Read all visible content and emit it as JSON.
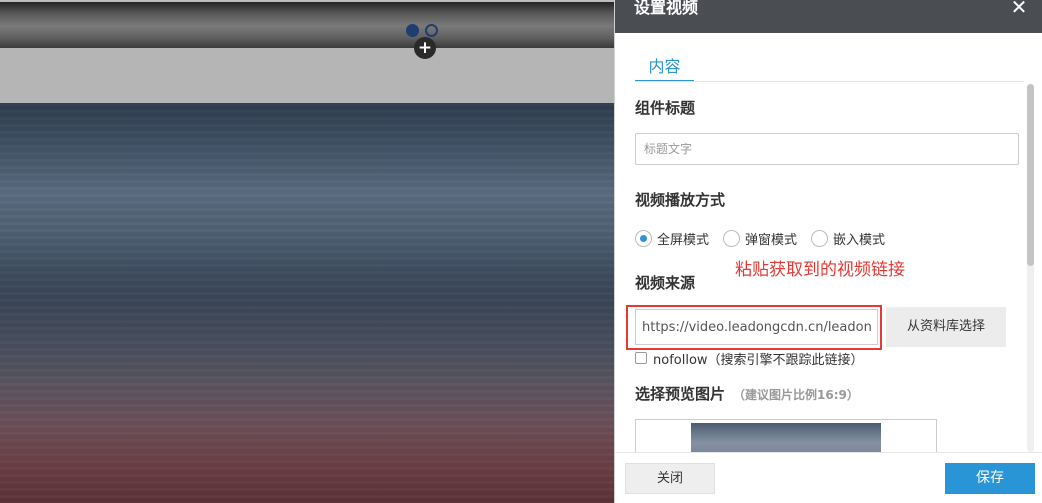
{
  "panel": {
    "title": "设置视频",
    "close_icon": "close-icon",
    "tab_content": "内容",
    "component_title_label": "组件标题",
    "component_title_placeholder": "标题文字",
    "play_mode_label": "视频播放方式",
    "play_modes": [
      {
        "label": "全屏模式",
        "selected": true
      },
      {
        "label": "弹窗模式",
        "selected": false
      },
      {
        "label": "嵌入模式",
        "selected": false
      }
    ],
    "annotation": "粘贴获取到的视频链接",
    "video_source_label": "视频来源",
    "video_url_value": "https://video.leadongcdn.cn/leadong",
    "library_button": "从资料库选择",
    "nofollow_label": "nofollow（搜索引擎不跟踪此链接）",
    "nofollow_checked": false,
    "preview_image_label": "选择预览图片",
    "preview_image_hint": "（建议图片比例16:9）",
    "close_button": "关闭",
    "save_button": "保存"
  },
  "colors": {
    "accent": "#2a95d6",
    "header_bg": "#4a4d52",
    "annotation_red": "#e53935"
  },
  "preview": {
    "add_icon": "plus-icon",
    "add_symbol": "+",
    "carousel_dots": 2,
    "carousel_active_index": 0
  }
}
